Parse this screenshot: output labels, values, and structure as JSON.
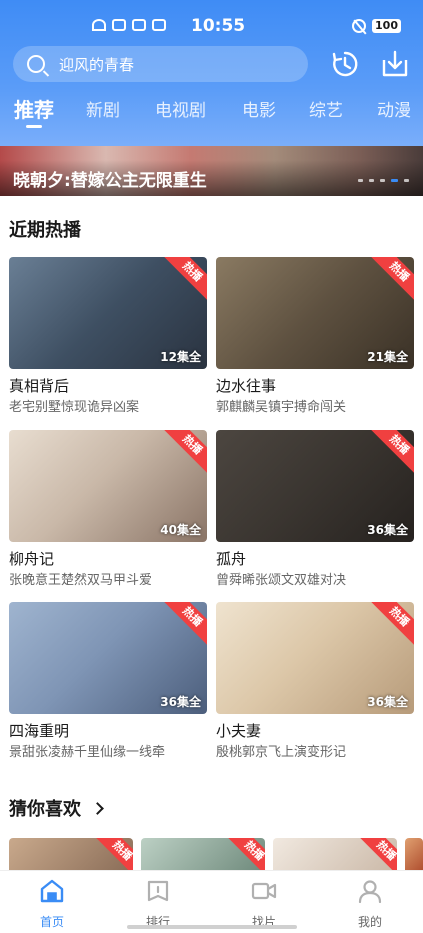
{
  "status_bar": {
    "time": "10:55",
    "battery": "100"
  },
  "search": {
    "placeholder": "迎风的青春"
  },
  "tabs": [
    {
      "label": "推荐",
      "active": true
    },
    {
      "label": "新剧"
    },
    {
      "label": "电视剧"
    },
    {
      "label": "电影"
    },
    {
      "label": "综艺"
    },
    {
      "label": "动漫"
    }
  ],
  "banner": {
    "title": "晓朝夕:替嫁公主无限重生",
    "page_count": 5,
    "active_index": 4
  },
  "sections": {
    "recent": {
      "title": "近期热播"
    },
    "guess": {
      "title": "猜你喜欢"
    }
  },
  "hot_label": "热播",
  "cards": [
    {
      "title": "真相背后",
      "subtitle": "老宅别墅惊现诡异凶案",
      "episodes": "12集全"
    },
    {
      "title": "边水往事",
      "subtitle": "郭麒麟吴镇宇搏命闯关",
      "episodes": "21集全"
    },
    {
      "title": "柳舟记",
      "subtitle": "张晚意王楚然双马甲斗爱",
      "episodes": "40集全"
    },
    {
      "title": "孤舟",
      "subtitle": "曾舜晞张颂文双雄对决",
      "episodes": "36集全"
    },
    {
      "title": "四海重明",
      "subtitle": "景甜张凌赫千里仙缘一线牵",
      "episodes": "36集全"
    },
    {
      "title": "小夫妻",
      "subtitle": "殷桃郭京飞上演变形记",
      "episodes": "36集全"
    }
  ],
  "colors": {
    "accent": "#3a8cf5",
    "hot_tag": "#f04040",
    "header_gradient_top": "#3f8cf5"
  },
  "bottom_nav": [
    {
      "label": "首页",
      "icon": "home-icon",
      "active": true
    },
    {
      "label": "排行",
      "icon": "ranking-icon"
    },
    {
      "label": "找片",
      "icon": "video-camera-icon"
    },
    {
      "label": "我的",
      "icon": "user-icon"
    }
  ]
}
